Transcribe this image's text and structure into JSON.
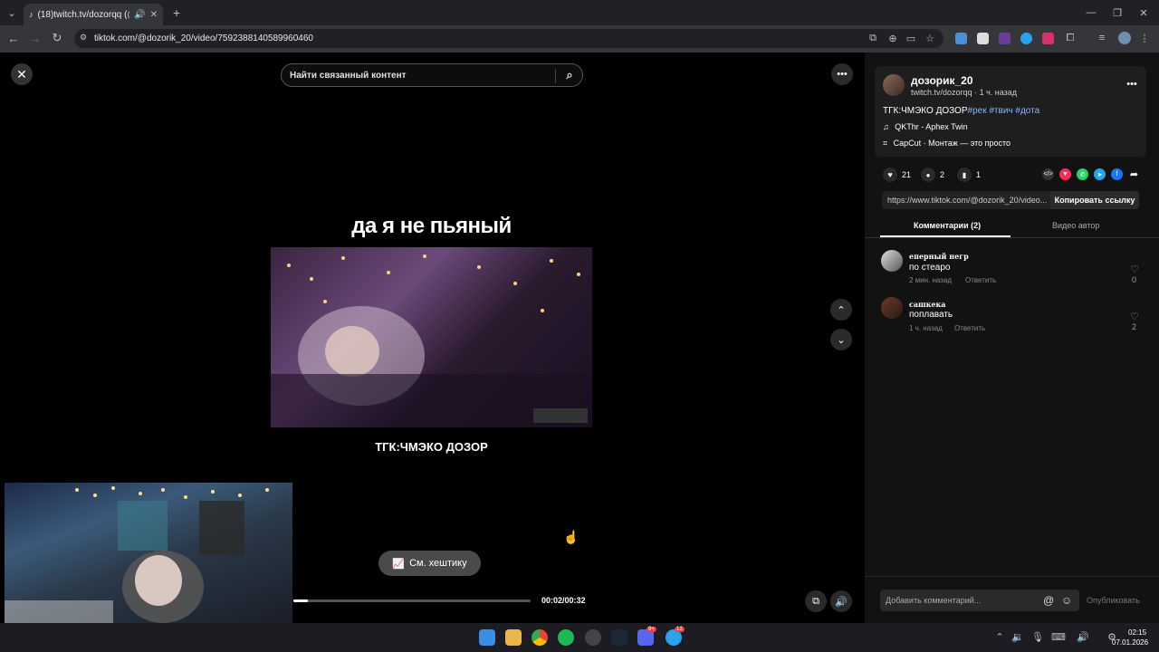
{
  "browser": {
    "tab_title": "(18)twitch.tv/dozorqq (@d...",
    "url": "tiktok.com/@dozorik_20/video/7592388140589960460"
  },
  "video": {
    "search_placeholder": "Найти связанный контент",
    "overlay_title": "да я не пьяный",
    "caption": "ТГК:ЧМЭКО ДОЗОР",
    "hashtag_button": "См. хештику",
    "timecode": "00:02/00:32",
    "progress": 0.0625
  },
  "author": {
    "name": "дозорик_20",
    "subtitle": "twitch.tv/dozorqq",
    "time": "1 ч. назад",
    "description": "ТГК:ЧМЭКО ДОЗОР",
    "hashtags": [
      "#рек",
      "#твич",
      "#дота"
    ],
    "music": "QKThr - Aphex Twin",
    "capcut": "CapCut · Монтаж — это просто"
  },
  "stats": {
    "likes": "21",
    "comments": "2",
    "saves": "1"
  },
  "link": {
    "url": "https://www.tiktok.com/@dozorik_20/video...",
    "copy_label": "Копировать ссылку"
  },
  "tabs": {
    "comments": "Комментарии (2)",
    "author_videos": "Видео автор"
  },
  "comments": [
    {
      "user": "еперный негр",
      "text": "по стеаро",
      "time": "2 мин. назад",
      "reply": "Ответить",
      "likes": "0"
    },
    {
      "user": "сашкека",
      "text": "поплавать",
      "time": "1 ч. назад",
      "reply": "Ответить",
      "likes": "2"
    }
  ],
  "composer": {
    "placeholder": "Добавить комментарий...",
    "publish": "Опубликовать"
  },
  "taskbar": {
    "time": "02:15",
    "date": "07.01.2026",
    "discord_badge": "9+",
    "telegram_badge": "12"
  },
  "colors": {
    "hashtag": "#8ab4f8",
    "accent": "#fe2c55"
  }
}
